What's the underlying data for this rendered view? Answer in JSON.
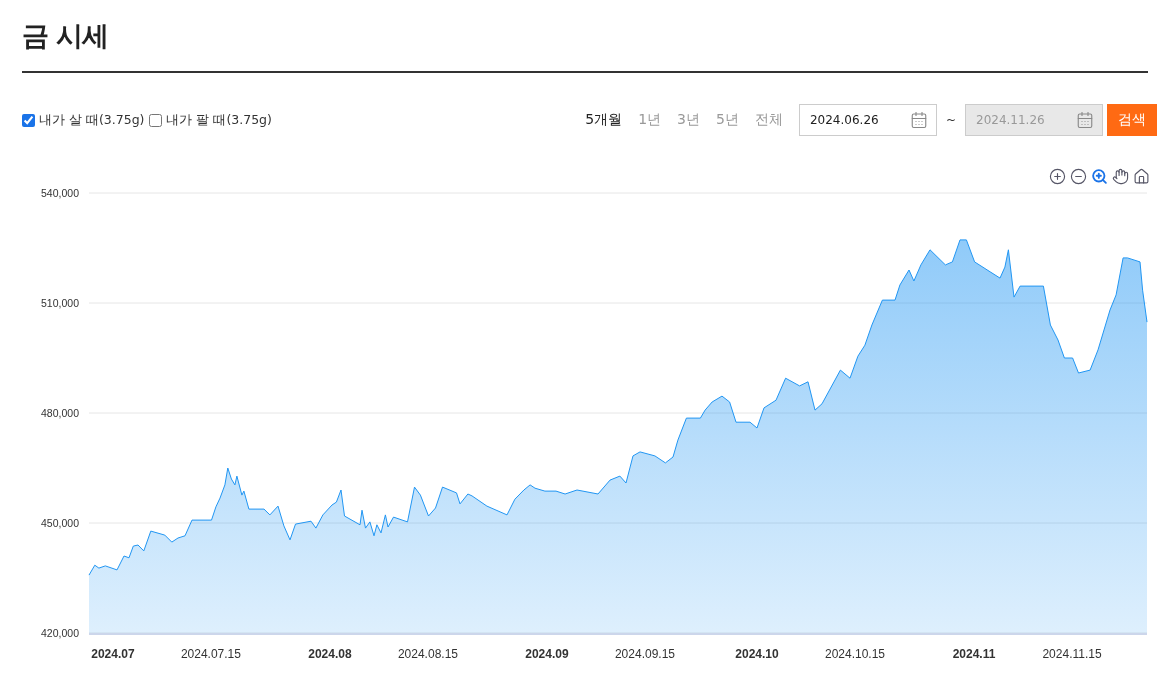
{
  "page": {
    "title": "금 시세"
  },
  "filters": [
    {
      "label": "내가 살 때(3.75g)",
      "checked": true
    },
    {
      "label": "내가 팔 때(3.75g)",
      "checked": false
    }
  ],
  "periods": [
    {
      "label": "5개월",
      "selected": true
    },
    {
      "label": "1년",
      "selected": false
    },
    {
      "label": "3년",
      "selected": false
    },
    {
      "label": "5년",
      "selected": false
    },
    {
      "label": "전체",
      "selected": false
    }
  ],
  "date_range": {
    "start": {
      "value": "2024.06.26",
      "disabled": false
    },
    "separator": "~",
    "end": {
      "value": "2024.11.26",
      "disabled": true
    }
  },
  "search_button": "검색",
  "chart_tools": [
    {
      "kind": "zoom-in",
      "selected": false
    },
    {
      "kind": "zoom-out",
      "selected": false
    },
    {
      "kind": "zoom-select",
      "selected": true
    },
    {
      "kind": "pan",
      "selected": false
    },
    {
      "kind": "reset",
      "selected": false
    }
  ],
  "chart": {
    "chart_data": {
      "type": "area",
      "grid": true,
      "xlim": [
        "2024-06-27T14:00",
        "2024-11-25T17:00"
      ],
      "ylim": [
        420000,
        540000
      ],
      "yticks": [
        {
          "value": 420000,
          "label": "420,000"
        },
        {
          "value": 450000,
          "label": "450,000"
        },
        {
          "value": 480000,
          "label": "480,000"
        },
        {
          "value": 510000,
          "label": "510,000"
        },
        {
          "value": 540000,
          "label": "540,000"
        }
      ],
      "xticks": [
        {
          "value": "2024-07-01",
          "label": "2024.07"
        },
        {
          "value": "2024-07-15",
          "label": "2024.07.15"
        },
        {
          "value": "2024-08-01",
          "label": "2024.08"
        },
        {
          "value": "2024-08-15",
          "label": "2024.08.15"
        },
        {
          "value": "2024-09-01",
          "label": "2024.09"
        },
        {
          "value": "2024-09-15",
          "label": "2024.09.15"
        },
        {
          "value": "2024-10-01",
          "label": "2024.10"
        },
        {
          "value": "2024-10-15",
          "label": "2024.10.15"
        },
        {
          "value": "2024-11-01",
          "label": "2024.11"
        },
        {
          "value": "2024-11-15",
          "label": "2024.11.15"
        }
      ],
      "x": [
        "2024-06-27T14:00",
        "2024-06-28T10:00",
        "2024-06-29T00:00",
        "2024-06-29T22:00",
        "2024-07-01T14:00",
        "2024-07-02T14:00",
        "2024-07-03T07:00",
        "2024-07-03T22:00",
        "2024-07-04T14:00",
        "2024-07-05T10:00",
        "2024-07-06T10:00",
        "2024-07-08T10:00",
        "2024-07-09T10:00",
        "2024-07-10T07:00",
        "2024-07-11T07:00",
        "2024-07-12T07:00",
        "2024-07-15T02:00",
        "2024-07-15T17:00",
        "2024-07-16T07:00",
        "2024-07-17T00:00",
        "2024-07-17T10:00",
        "2024-07-17T22:00",
        "2024-07-18T10:00",
        "2024-07-18T17:00",
        "2024-07-19T10:00",
        "2024-07-19T17:00",
        "2024-07-20T10:00",
        "2024-07-22T14:00",
        "2024-07-23T10:00",
        "2024-07-24T14:00",
        "2024-07-25T10:00",
        "2024-07-26T07:00",
        "2024-07-27T02:00",
        "2024-07-29T07:00",
        "2024-07-30T00:00",
        "2024-07-31T00:00",
        "2024-08-01T07:00",
        "2024-08-01T22:00",
        "2024-08-02T14:00",
        "2024-08-03T02:00",
        "2024-08-05T07:00",
        "2024-08-05T14:00",
        "2024-08-06T02:00",
        "2024-08-06T17:00",
        "2024-08-07T07:00",
        "2024-08-07T17:00",
        "2024-08-08T07:00",
        "2024-08-08T22:00",
        "2024-08-09T07:00",
        "2024-08-10T02:00",
        "2024-08-12T02:00",
        "2024-08-13T02:00",
        "2024-08-13T22:00",
        "2024-08-15T02:00",
        "2024-08-16T02:00",
        "2024-08-17T02:00",
        "2024-08-19T02:00",
        "2024-08-19T14:00",
        "2024-08-20T17:00",
        "2024-08-21T07:00",
        "2024-08-23T10:00",
        "2024-08-26T07:00",
        "2024-08-27T10:00",
        "2024-08-28T17:00",
        "2024-08-29T14:00",
        "2024-08-30T07:00",
        "2024-08-31T17:00",
        "2024-09-02T07:00",
        "2024-09-03T14:00",
        "2024-09-05T07:00",
        "2024-09-08T07:00",
        "2024-09-10T00:00",
        "2024-09-11T10:00",
        "2024-09-12T07:00",
        "2024-09-13T07:00",
        "2024-09-14T07:00",
        "2024-09-16T10:00",
        "2024-09-17T22:00",
        "2024-09-19T00:00",
        "2024-09-19T17:00",
        "2024-09-20T22:00",
        "2024-09-22T22:00",
        "2024-09-23T14:00",
        "2024-09-24T14:00",
        "2024-09-26T00:00",
        "2024-09-27T02:00",
        "2024-09-28T00:00",
        "2024-09-30T00:00",
        "2024-10-01T00:00",
        "2024-10-02T00:00",
        "2024-10-03T17:00",
        "2024-10-05T02:00",
        "2024-10-07T02:00",
        "2024-10-08T07:00",
        "2024-10-09T07:00",
        "2024-10-10T07:00",
        "2024-10-12T22:00",
        "2024-10-14T07:00",
        "2024-10-15T10:00",
        "2024-10-16T10:00",
        "2024-10-17T10:00",
        "2024-10-18T22:00",
        "2024-10-20T17:00",
        "2024-10-21T10:00",
        "2024-10-22T17:00",
        "2024-10-23T10:00",
        "2024-10-24T10:00",
        "2024-10-25T17:00",
        "2024-10-27T22:00",
        "2024-10-28T22:00",
        "2024-10-30T00:00",
        "2024-10-30T22:00",
        "2024-11-01T02:00",
        "2024-11-03T07:00",
        "2024-11-04T17:00",
        "2024-11-05T10:00",
        "2024-11-05T22:00",
        "2024-11-06T17:00",
        "2024-11-07T14:00",
        "2024-11-10T22:00",
        "2024-11-11T22:00",
        "2024-11-13T00:00",
        "2024-11-13T22:00",
        "2024-11-15T02:00",
        "2024-11-15T22:00",
        "2024-11-17T14:00",
        "2024-11-18T17:00",
        "2024-11-20T10:00",
        "2024-11-21T07:00",
        "2024-11-22T07:00",
        "2024-11-22T22:00",
        "2024-11-24T17:00",
        "2024-11-25T02:00",
        "2024-11-25T17:00"
      ],
      "series": [
        {
          "color": "#2196f3",
          "values": [
            435800,
            438500,
            437700,
            438300,
            437200,
            441000,
            440500,
            443700,
            444000,
            442400,
            447800,
            446700,
            444800,
            445900,
            446500,
            450800,
            450800,
            454400,
            456800,
            460400,
            465000,
            462000,
            460400,
            462800,
            457600,
            458700,
            453800,
            453800,
            452200,
            454600,
            449200,
            445400,
            449700,
            450500,
            448600,
            452200,
            454900,
            455700,
            459000,
            451900,
            449500,
            453500,
            448600,
            450300,
            446500,
            449500,
            447300,
            452200,
            448900,
            451600,
            450300,
            459800,
            457600,
            451900,
            454100,
            459800,
            458200,
            455200,
            457900,
            457400,
            454600,
            452200,
            456500,
            459000,
            460400,
            459500,
            458700,
            458700,
            457900,
            459000,
            457900,
            461700,
            462800,
            460900,
            468300,
            469400,
            468300,
            466400,
            468000,
            472600,
            478600,
            478600,
            480800,
            483000,
            484600,
            483000,
            477500,
            477500,
            475900,
            481400,
            483500,
            489500,
            487400,
            488500,
            480800,
            482500,
            491700,
            489500,
            495500,
            498500,
            504000,
            510800,
            510800,
            514900,
            519000,
            516000,
            520400,
            524500,
            520400,
            521200,
            527200,
            527200,
            521200,
            518500,
            516800,
            519800,
            524500,
            511600,
            514600,
            514600,
            504000,
            499900,
            495000,
            495000,
            490900,
            491700,
            497200,
            508100,
            512200,
            522300,
            522300,
            521200,
            513500,
            504800
          ]
        }
      ]
    }
  }
}
